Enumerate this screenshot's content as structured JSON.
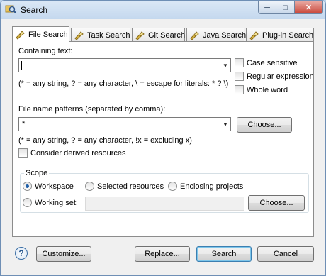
{
  "window": {
    "title": "Search"
  },
  "tabs": [
    {
      "label": "File Search"
    },
    {
      "label": "Task Search"
    },
    {
      "label": "Git Search"
    },
    {
      "label": "Java Search"
    },
    {
      "label": "Plug-in Search"
    }
  ],
  "file_search": {
    "containing_text_label": "Containing text:",
    "containing_text_value": "",
    "containing_hint": "(* = any string, ? = any character, \\ = escape for literals: * ? \\)",
    "case_sensitive": "Case sensitive",
    "regular_expression": "Regular expression",
    "whole_word": "Whole word",
    "file_patterns_label": "File name patterns (separated by comma):",
    "file_patterns_value": "*",
    "choose_label": "Choose...",
    "patterns_hint": "(* = any string, ? = any character, !x = excluding x)",
    "consider_derived": "Consider derived resources"
  },
  "scope": {
    "title": "Scope",
    "workspace": "Workspace",
    "selected_resources": "Selected resources",
    "enclosing_projects": "Enclosing projects",
    "working_set": "Working set:",
    "choose_label": "Choose...",
    "selected": "Workspace"
  },
  "footer": {
    "help": "?",
    "customize": "Customize...",
    "replace": "Replace...",
    "search": "Search",
    "cancel": "Cancel"
  },
  "icons": {
    "window": "search-icon",
    "tab": "flashlight-icon",
    "help": "help-icon"
  }
}
